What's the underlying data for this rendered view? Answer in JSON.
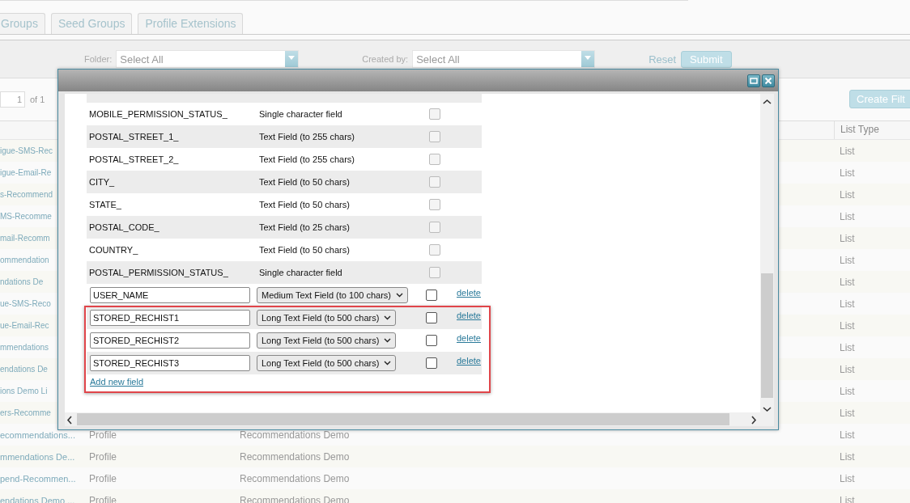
{
  "tabs": [
    {
      "label": "Groups",
      "selected": false
    },
    {
      "label": "Seed Groups",
      "selected": false
    },
    {
      "label": "Profile Extensions",
      "selected": false
    }
  ],
  "filters": {
    "folder_label": "Folder:",
    "folder_value": "Select All",
    "created_by_label": "Created by:",
    "created_by_value": "Select All",
    "reset": "Reset",
    "submit": "Submit"
  },
  "pager": {
    "page": "1",
    "of": "of 1"
  },
  "create_button": "Create Filt",
  "table": {
    "columns": [
      "List Type"
    ],
    "rows": [
      {
        "name": "igue-SMS-Rec",
        "list_type": "List"
      },
      {
        "name": "igue-Email-Re",
        "list_type": "List"
      },
      {
        "name": "s-Recommend",
        "list_type": "List"
      },
      {
        "name": "MS-Recomme",
        "list_type": "List"
      },
      {
        "name": "mail-Recomm",
        "list_type": "List"
      },
      {
        "name": "ommendation",
        "list_type": "List"
      },
      {
        "name": "ndations De",
        "list_type": "List"
      },
      {
        "name": "ue-SMS-Reco",
        "list_type": "List"
      },
      {
        "name": "ue-Email-Rec",
        "list_type": "List"
      },
      {
        "name": "mmendations",
        "list_type": "List"
      },
      {
        "name": "endations De",
        "list_type": "List"
      },
      {
        "name": "ions Demo Li",
        "list_type": "List"
      },
      {
        "name": "ers-Recomme",
        "list_type": "List"
      },
      {
        "name": "ecommendations...",
        "type": "Profile",
        "folder": "Recommendations Demo",
        "list_type": "List"
      },
      {
        "name": "mmendations De...",
        "type": "Profile",
        "folder": "Recommendations Demo",
        "list_type": "List"
      },
      {
        "name": "pend-Recommen...",
        "type": "Profile",
        "folder": "Recommendations Demo",
        "list_type": "List"
      },
      {
        "name": "endations Demo ...",
        "type": "Profile",
        "folder": "Recommendations Demo",
        "list_type": "List"
      }
    ]
  },
  "dialog": {
    "fields": [
      {
        "kind": "fixed",
        "name": "MOBILE_PERMISSION_STATUS_",
        "type": "Single character field",
        "checked": false
      },
      {
        "kind": "fixed",
        "name": "POSTAL_STREET_1_",
        "type": "Text Field (to 255 chars)",
        "checked": false
      },
      {
        "kind": "fixed",
        "name": "POSTAL_STREET_2_",
        "type": "Text Field (to 255 chars)",
        "checked": false
      },
      {
        "kind": "fixed",
        "name": "CITY_",
        "type": "Text Field (to 50 chars)",
        "checked": false
      },
      {
        "kind": "fixed",
        "name": "STATE_",
        "type": "Text Field (to 50 chars)",
        "checked": false
      },
      {
        "kind": "fixed",
        "name": "POSTAL_CODE_",
        "type": "Text Field (to 25 chars)",
        "checked": false
      },
      {
        "kind": "fixed",
        "name": "COUNTRY_",
        "type": "Text Field (to 50 chars)",
        "checked": false
      },
      {
        "kind": "fixed",
        "name": "POSTAL_PERMISSION_STATUS_",
        "type": "Single character field",
        "checked": false
      },
      {
        "kind": "editable",
        "name": "USER_NAME",
        "type": "Medium Text Field (to 100 chars)",
        "checked": false,
        "delete": "delete"
      },
      {
        "kind": "editable",
        "name": "STORED_RECHIST1",
        "type": "Long Text Field (to 500 chars)",
        "checked": false,
        "delete": "delete"
      },
      {
        "kind": "editable",
        "name": "STORED_RECHIST2",
        "type": "Long Text Field (to 500 chars)",
        "checked": false,
        "delete": "delete"
      },
      {
        "kind": "editable",
        "name": "STORED_RECHIST3",
        "type": "Long Text Field (to 500 chars)",
        "checked": false,
        "delete": "delete"
      }
    ],
    "add_link": "Add new field",
    "highlight": true
  }
}
